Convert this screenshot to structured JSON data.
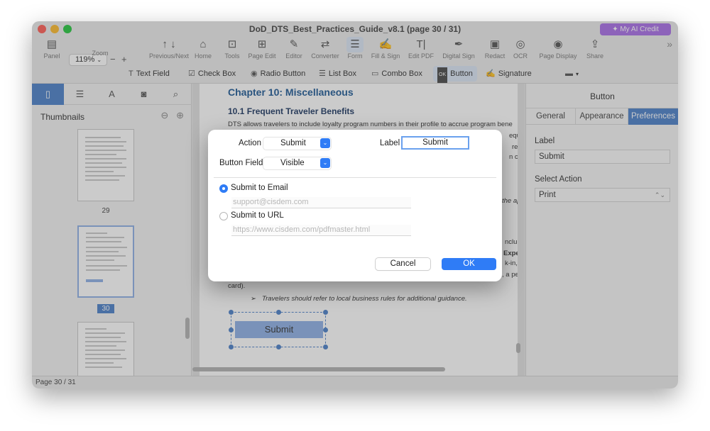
{
  "window": {
    "title": "DoD_DTS_Best_Practices_Guide_v8.1 (page 30 / 31)",
    "ai_credit": "✦ My AI Credit"
  },
  "toolbar": {
    "zoom": "119%",
    "items": [
      {
        "label": "Panel",
        "icon": "panel-icon"
      },
      {
        "label": "Zoom",
        "icon": "zoom-icon"
      },
      {
        "label": "Previous/Next",
        "icon": "previous-next-icon"
      },
      {
        "label": "Home",
        "icon": "home-icon"
      },
      {
        "label": "Tools",
        "icon": "tools-icon"
      },
      {
        "label": "Page Edit",
        "icon": "page-edit-icon"
      },
      {
        "label": "Editor",
        "icon": "editor-icon"
      },
      {
        "label": "Converter",
        "icon": "converter-icon"
      },
      {
        "label": "Form",
        "icon": "form-icon"
      },
      {
        "label": "Fill & Sign",
        "icon": "fill-sign-icon"
      },
      {
        "label": "Edit PDF",
        "icon": "edit-pdf-icon"
      },
      {
        "label": "Digital Sign",
        "icon": "digital-sign-icon"
      },
      {
        "label": "Redact",
        "icon": "redact-icon"
      },
      {
        "label": "OCR",
        "icon": "ocr-icon"
      },
      {
        "label": "Page Display",
        "icon": "page-display-icon"
      },
      {
        "label": "Share",
        "icon": "share-icon"
      }
    ]
  },
  "form_toolbar": {
    "text_field": "Text Field",
    "check_box": "Check Box",
    "radio_button": "Radio Button",
    "list_box": "List Box",
    "combo_box": "Combo Box",
    "button": "Button",
    "signature": "Signature"
  },
  "left_panel": {
    "title": "Thumbnails",
    "pages": [
      "29",
      "30"
    ]
  },
  "document": {
    "chapter_title": "Chapter 10: Miscellaneous",
    "section_title": "10.1 Frequent Traveler Benefits",
    "line1": "DTS allows travelers to include loyalty program numbers in their profile to accrue program bene",
    "frag_eque": "eque",
    "frag_re": "re",
    "frag_n_co": "n co",
    "frag_the_ap": "the ap",
    "frag_nclu": "nclu",
    "frag_expe": "Expe",
    "frag_k_in": "k-in,",
    "frag_a_pe": ", a pe",
    "frag_card": "card).",
    "bullet": "Travelers should refer to local business rules for additional guidance.",
    "button_label": "Submit"
  },
  "right_panel": {
    "title": "Button",
    "tabs": [
      "General",
      "Appearance",
      "Preferences"
    ],
    "label_title": "Label",
    "label_value": "Submit",
    "select_action_title": "Select Action",
    "select_action_value": "Print"
  },
  "status": {
    "page": "Page 30 / 31"
  },
  "dialog": {
    "action_label": "Action",
    "action_value": "Submit",
    "label_label": "Label",
    "label_value": "Submit",
    "button_field_label": "Button Field",
    "button_field_value": "Visible",
    "submit_email": "Submit to Email",
    "email_placeholder": "support@cisdem.com",
    "submit_url": "Submit to URL",
    "url_placeholder": "https://www.cisdem.com/pdfmaster.html",
    "cancel": "Cancel",
    "ok": "OK"
  },
  "colors": {
    "accent": "#4d81c9",
    "dialog_blue": "#2f7cf6",
    "ai_purple": "#a970e8"
  }
}
